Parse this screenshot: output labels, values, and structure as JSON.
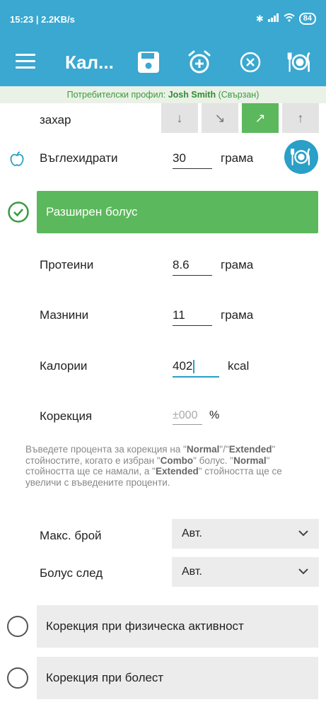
{
  "status_bar": {
    "time": "15:23 | 2.2KB/s",
    "battery": "84"
  },
  "app_bar": {
    "title": "Кал..."
  },
  "profile_bar": {
    "prefix": "Потребителски профил:",
    "user": "Josh Smith",
    "suffix": "(Свързан)"
  },
  "sugar_row": {
    "label": "захар",
    "arrows": [
      "↓",
      "↘",
      "↗",
      "↑"
    ],
    "active_index": 2
  },
  "carbs": {
    "label": "Въглехидрати",
    "value": "30",
    "unit": "грама"
  },
  "extended_bolus": {
    "label": "Разширен болус"
  },
  "proteins": {
    "label": "Протеини",
    "value": "8.6",
    "unit": "грама"
  },
  "fats": {
    "label": "Мазнини",
    "value": "11",
    "unit": "грама"
  },
  "calories": {
    "label": "Калории",
    "value": "402",
    "unit": "kcal"
  },
  "correction": {
    "label": "Корекция",
    "placeholder": "±000",
    "unit": "%"
  },
  "hint": {
    "p1": "Въведете процента за корекция на \"",
    "normal1": "Normal",
    "p2": "\"/\"",
    "extended1": "Extended",
    "p3": "\" стойностите, когато е избран \"",
    "combo": "Combo",
    "p4": "\" болус. \"",
    "normal2": "Normal",
    "p5": "\" стойността ще се намали, а \"",
    "extended2": "Extended",
    "p6": "\" стойността ще се увеличи с въведените проценти."
  },
  "max_count": {
    "label": "Макс. брой",
    "value": "Авт."
  },
  "bolus_after": {
    "label": "Болус след",
    "value": "Авт."
  },
  "options": [
    {
      "label": "Корекция при физическа активност"
    },
    {
      "label": "Корекция при болест"
    }
  ],
  "colors": {
    "primary": "#3aa8d0",
    "green": "#5cb85c",
    "profile_bg": "#eaf1e6",
    "accent_underline": "#2a9fc7"
  }
}
